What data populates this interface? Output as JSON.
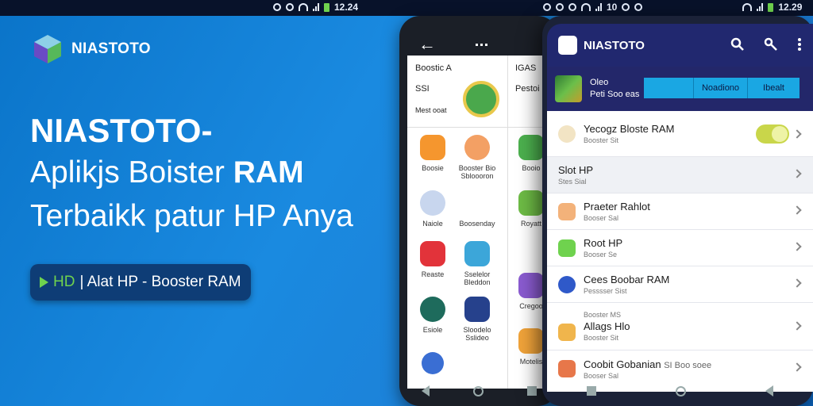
{
  "status_left": {
    "time": "12.24"
  },
  "status_right": {
    "signal_text": "10",
    "time": "12.29"
  },
  "brand": {
    "name": "NIASTOTO"
  },
  "headline": {
    "line1": "NIASTOTO-",
    "line2_prefix": "Aplikjs Boister ",
    "line2_bold": "RAM",
    "line3": "Terbaikk patur HP Anya"
  },
  "pill": {
    "hd": "HD",
    "text": "| Alat HP - Booster RAM"
  },
  "colors": {
    "accent_green": "#6fd24e",
    "header_blue": "#21286f",
    "tab_cyan": "#1aa7e3"
  },
  "phone_back": {
    "header_left_1": "Boostic A",
    "header_left_2": "SSI",
    "header_left_3": "Mest ooat",
    "header_right": "IGAS",
    "header_right_2": "Pestoi",
    "grid": [
      {
        "label": "Boosie",
        "icon": "flash-icon"
      },
      {
        "label": "Booster Bio Sbloooron",
        "icon": "dial-icon"
      },
      {
        "label": "Booio",
        "icon": "android-icon"
      },
      {
        "label": "Naiole",
        "icon": "circle-icon"
      },
      {
        "label": "Boosenday",
        "icon": ""
      },
      {
        "label": "Royatt",
        "icon": "chart-icon"
      },
      {
        "label": "Reaste",
        "icon": "record-icon"
      },
      {
        "label": "Sselelor Bleddon",
        "icon": "bolt-icon"
      },
      {
        "label": "Cregoo",
        "icon": "edit-icon"
      },
      {
        "label": "Esiole",
        "icon": "leaf-icon"
      },
      {
        "label": "Sloodelo Sslideo",
        "icon": "screen-icon"
      },
      {
        "label": "Motelis",
        "icon": "cog-icon"
      }
    ]
  },
  "phone_front": {
    "title": "NIASTOTO",
    "banner": {
      "line1": "Oleo",
      "line2": "Peti Soo eas",
      "tab1": "",
      "tab2": "Noadiono",
      "tab3": "Ibealt"
    },
    "rows": [
      {
        "title": "Yecogz Bloste RAM",
        "sub": "Booster Sit",
        "icon_color": "#f2e4c4"
      },
      {
        "title": "Slot HP",
        "sub": "Stes Sial",
        "icon_color": ""
      },
      {
        "title": "Praeter Rahlot",
        "sub": "Booser Sal",
        "icon_color": "#f3b27a"
      },
      {
        "title": "Root HP",
        "sub": "Booser Se",
        "icon_color": "#6fd24e"
      },
      {
        "title": "Cees Boobar RAM",
        "sub": "Pesssser Sist",
        "icon_color": "#2f59c9"
      },
      {
        "title": "Allags Hlo",
        "sub": "Booster Sit",
        "icon_color": "#f0b54c",
        "pre": "Booster MS"
      },
      {
        "title": "Coobit Gobanian",
        "title_extra": "SI Boo soee",
        "sub": "Booser Sal",
        "icon_color": "#e7774a"
      }
    ]
  }
}
